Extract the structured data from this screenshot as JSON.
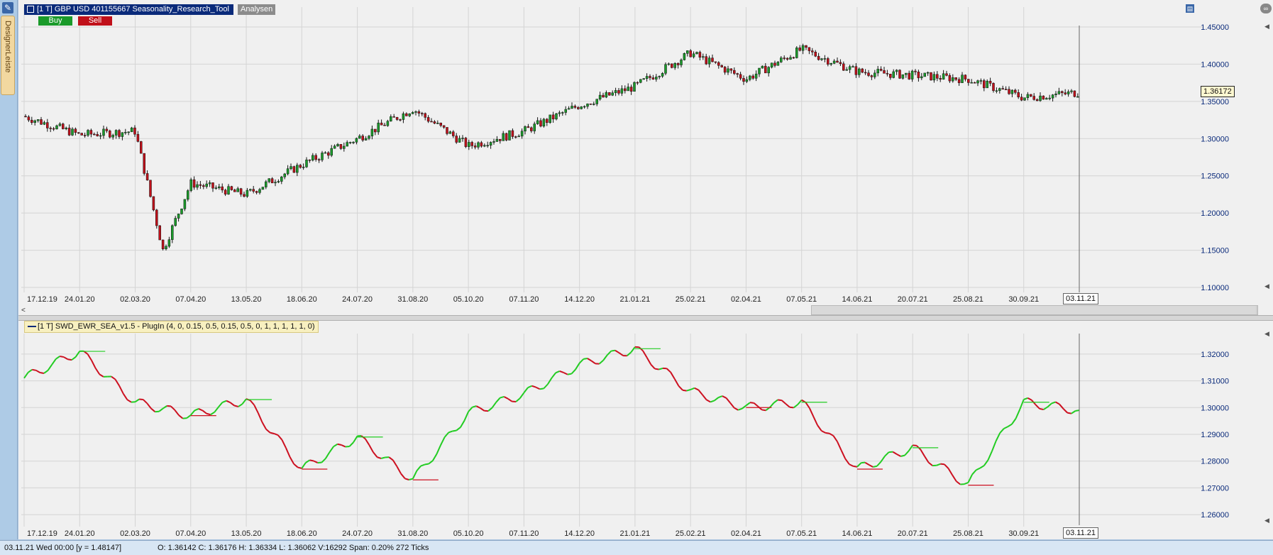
{
  "sidebar": {
    "tab_label": "DesignerLeiste",
    "wrench_icon": "wrench-icon"
  },
  "header": {
    "instrument_title": "[1 T] GBP USD   401155667 Seasonality_Research_Tool",
    "analysen_label": "Analysen",
    "buy_label": "Buy",
    "sell_label": "Sell"
  },
  "price_panel": {
    "current_price_tag": "1.36172",
    "y_ticks": [
      "1.45000",
      "1.40000",
      "1.35000",
      "1.30000",
      "1.25000",
      "1.20000",
      "1.15000",
      "1.10000"
    ],
    "x_ticks": [
      "17.12.19",
      "24.01.20",
      "02.03.20",
      "07.04.20",
      "13.05.20",
      "18.06.20",
      "24.07.20",
      "31.08.20",
      "05.10.20",
      "07.11.20",
      "14.12.20",
      "21.01.21",
      "25.02.21",
      "02.04.21",
      "07.05.21",
      "14.06.21",
      "20.07.21",
      "25.08.21",
      "30.09.21"
    ],
    "cursor_date": "03.11.21",
    "colors": {
      "up": "#1a9a2a",
      "down": "#c0101a",
      "axis_text": "#0a2a7a"
    }
  },
  "indicator_panel": {
    "label": "[1 T] SWD_EWR_SEA_v1.5 - PlugIn  (4, 0, 0.15, 0.5, 0.15, 0.5, 0, 1, 1, 1, 1, 1, 0)",
    "y_ticks": [
      "1.32000",
      "1.31000",
      "1.30000",
      "1.29000",
      "1.28000",
      "1.27000",
      "1.26000"
    ],
    "x_ticks": [
      "17.12.19",
      "24.01.20",
      "02.03.20",
      "07.04.20",
      "13.05.20",
      "18.06.20",
      "24.07.20",
      "31.08.20",
      "05.10.20",
      "07.11.20",
      "14.12.20",
      "21.01.21",
      "25.02.21",
      "02.04.21",
      "07.05.21",
      "14.06.21",
      "20.07.21",
      "25.08.21",
      "30.09.21"
    ],
    "cursor_date": "03.11.21",
    "colors": {
      "rise": "#22cc22",
      "fall": "#cc1020",
      "turn": "#3050d0"
    }
  },
  "status_bar": {
    "datetime": "03.11.21 Wed  00:00 [y = 1.48147]",
    "ohlc": "O: 1.36142 C: 1.36176 H: 1.36334 L: 1.36062 V:16292 Span: 0.20% 272 Ticks"
  },
  "chart_data": [
    {
      "type": "line",
      "description_series": "GBP USD close (candlesticks in original)",
      "x": [
        "17.12.19",
        "24.01.20",
        "02.03.20",
        "20.03.20",
        "07.04.20",
        "13.05.20",
        "18.06.20",
        "24.07.20",
        "31.08.20",
        "05.10.20",
        "07.11.20",
        "14.12.20",
        "21.01.21",
        "25.02.21",
        "02.04.21",
        "07.05.21",
        "14.06.21",
        "20.07.21",
        "25.08.21",
        "30.09.21",
        "03.11.21"
      ],
      "series": [
        {
          "values": [
            1.33,
            1.305,
            1.31,
            1.15,
            1.24,
            1.225,
            1.265,
            1.3,
            1.34,
            1.29,
            1.31,
            1.345,
            1.37,
            1.415,
            1.38,
            1.42,
            1.39,
            1.385,
            1.38,
            1.355,
            1.362
          ]
        }
      ],
      "ylim": [
        1.1,
        1.45
      ]
    },
    {
      "type": "line",
      "x": [
        "17.12.19",
        "24.01.20",
        "02.03.20",
        "07.04.20",
        "13.05.20",
        "18.06.20",
        "24.07.20",
        "31.08.20",
        "05.10.20",
        "07.11.20",
        "14.12.20",
        "21.01.21",
        "25.02.21",
        "02.04.21",
        "07.05.21",
        "14.06.21",
        "20.07.21",
        "25.08.21",
        "30.09.21",
        "03.11.21"
      ],
      "series": [
        {
          "values": [
            1.311,
            1.321,
            1.302,
            1.297,
            1.303,
            1.277,
            1.289,
            1.273,
            1.298,
            1.305,
            1.316,
            1.322,
            1.306,
            1.3,
            1.302,
            1.277,
            1.285,
            1.271,
            1.302,
            1.299
          ]
        }
      ],
      "ylim": [
        1.255,
        1.325
      ]
    }
  ]
}
